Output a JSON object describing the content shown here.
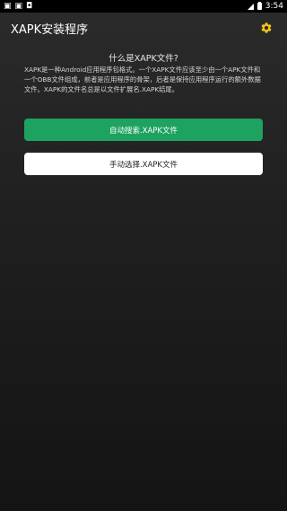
{
  "status_bar": {
    "left_icons": [
      "photo-icon",
      "photo-icon",
      "notification-icon"
    ],
    "time": "3:54"
  },
  "app_bar": {
    "title": "XAPK安装程序",
    "settings_icon": "gear-icon",
    "accent": "#f5c518"
  },
  "content": {
    "question": "什么是XAPK文件?",
    "description": "XAPK是一种Android应用程序包格式。一个XAPK文件应该至少由一个APK文件和一个OBB文件组成，前者是应用程序的骨架，后者是保持应用程序运行的额外数据文件。XAPK的文件名总是以文件扩展名.XAPK结尾。"
  },
  "buttons": {
    "auto_search_label": "自动搜索.XAPK文件",
    "auto_search_color": "#1ea260",
    "manual_select_label": "手动选择.XAPK文件",
    "manual_select_color": "#ffffff"
  }
}
